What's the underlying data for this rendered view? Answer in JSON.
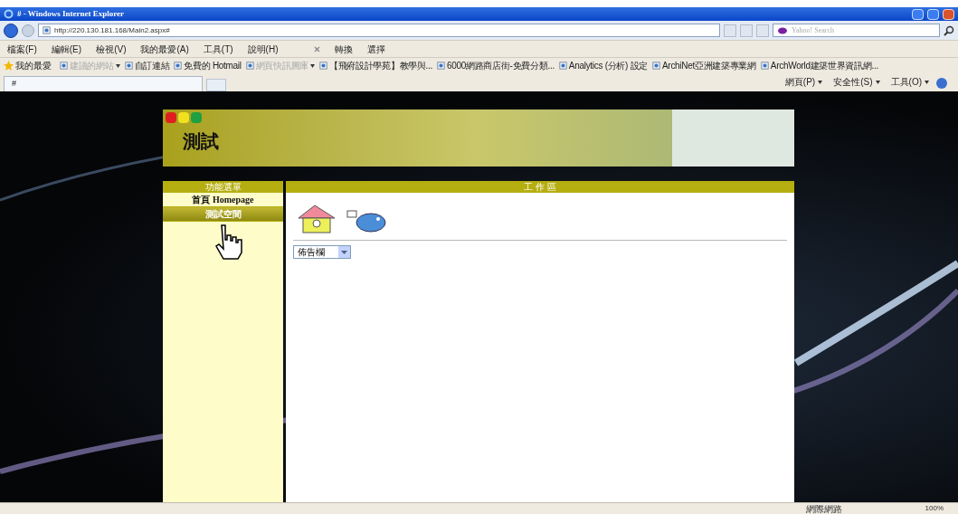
{
  "window": {
    "title": "# - Windows Internet Explorer"
  },
  "address_bar": {
    "url": "http://220.130.181.168/Main2.aspx#",
    "search_placeholder": "Yahoo! Search"
  },
  "menu_bar": [
    "檔案(F)",
    "編輯(E)",
    "檢視(V)",
    "我的最愛(A)",
    "工具(T)",
    "說明(H)"
  ],
  "toolbar": [
    "轉換",
    "選擇"
  ],
  "favorites_bar": {
    "label": "我的最愛",
    "items": [
      {
        "label": "建議的網站",
        "dropdown": true,
        "dim": true
      },
      {
        "label": "自訂連結",
        "dropdown": false,
        "dim": false
      },
      {
        "label": "免費的 Hotmail",
        "dropdown": false,
        "dim": false
      },
      {
        "label": "網頁快訊圖庫",
        "dropdown": true,
        "dim": true
      },
      {
        "label": "【飛府設計學苑】教學與...",
        "dropdown": false,
        "dim": false
      },
      {
        "label": "6000網路商店街-免費分類...",
        "dropdown": false,
        "dim": false
      },
      {
        "label": "Analytics (分析) 設定",
        "dropdown": false,
        "dim": false
      },
      {
        "label": "ArchiNet亞洲建築專業網",
        "dropdown": false,
        "dim": false
      },
      {
        "label": "ArchWorld建築世界資訊網...",
        "dropdown": false,
        "dim": false
      }
    ]
  },
  "tabs": [
    {
      "label": "#",
      "selected": true
    }
  ],
  "command_bar": [
    "網頁(P)",
    "安全性(S)",
    "工具(O)"
  ],
  "page": {
    "site_title": "測試",
    "sidebar": {
      "title": "功能選單",
      "items": [
        {
          "label": "首頁 Homepage",
          "selected": false
        },
        {
          "label": "測試空間",
          "selected": true
        }
      ]
    },
    "workspace": {
      "title": "工 作 區",
      "dropdown": "佈告欄"
    }
  },
  "status_bar": {
    "zone": "網際網路",
    "zoom": "100%"
  }
}
